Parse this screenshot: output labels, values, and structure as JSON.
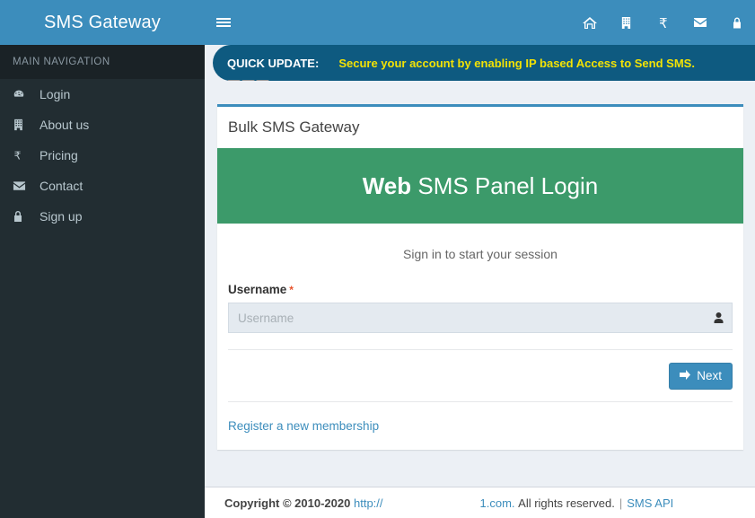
{
  "sidebar": {
    "brand": "SMS Gateway",
    "nav_header": "MAIN NAVIGATION",
    "items": [
      {
        "label": "Login",
        "icon": "dashboard-icon"
      },
      {
        "label": "About us",
        "icon": "building-icon"
      },
      {
        "label": "Pricing",
        "icon": "rupee-icon"
      },
      {
        "label": "Contact",
        "icon": "envelope-icon"
      },
      {
        "label": "Sign up",
        "icon": "lock-icon"
      }
    ]
  },
  "header": {
    "menu_toggle": "hamburger-icon",
    "icons": [
      {
        "name": "home-icon"
      },
      {
        "name": "building-icon"
      },
      {
        "name": "rupee-icon"
      },
      {
        "name": "envelope-icon"
      },
      {
        "name": "lock-icon"
      }
    ]
  },
  "quick_update": {
    "label": "QUICK UPDATE:",
    "message": "Secure your account by enabling IP based Access to Send SMS."
  },
  "marquee_controls": [
    {
      "name": "pause-button"
    },
    {
      "name": "rewind-button"
    },
    {
      "name": "forward-button"
    }
  ],
  "card": {
    "title": "Bulk SMS Gateway",
    "banner_bold": "Web",
    "banner_rest": " SMS Panel Login",
    "signin_message": "Sign in to start your session",
    "username_label": "Username",
    "required_mark": "*",
    "username_value": "",
    "username_placeholder": "Username",
    "next_label": "Next",
    "register_label": "Register a new membership"
  },
  "footer": {
    "copyright": "Copyright © 2010-2020",
    "url_prefix": "http://",
    "url_suffix": "1.com.",
    "rights": "All rights reserved.",
    "separator": "|",
    "api_link": "SMS API"
  },
  "colors": {
    "header_blue": "#3c8dbc",
    "quickbar_blue": "#0e5a80",
    "quick_text_yellow": "#f2e205",
    "sidebar_dark": "#222d32",
    "sidebar_header_dark": "#1a2226",
    "panel_green": "#3c9a6a",
    "content_bg": "#ecf0f5",
    "required_star": "#e8532c",
    "link_blue": "#3c8dbc"
  }
}
